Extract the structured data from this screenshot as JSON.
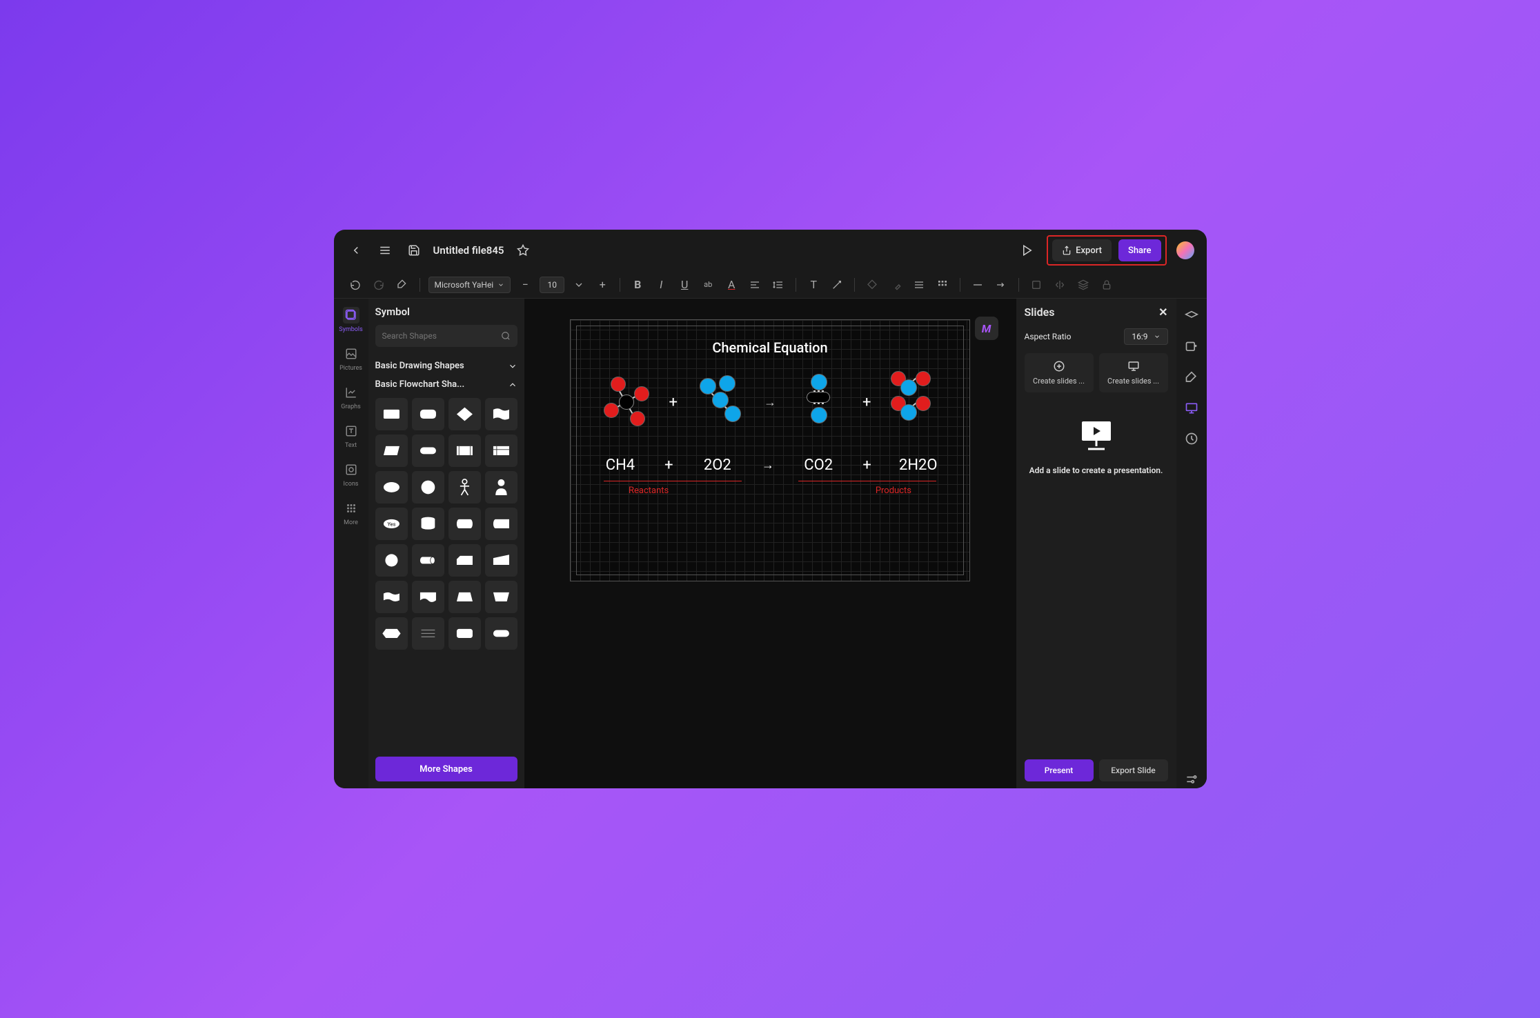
{
  "titlebar": {
    "filename": "Untitled file845",
    "export_label": "Export",
    "share_label": "Share"
  },
  "toolbar": {
    "font": "Microsoft YaHei",
    "size": "10"
  },
  "leftrail": {
    "items": [
      {
        "label": "Symbols",
        "icon": "shapes"
      },
      {
        "label": "Pictures",
        "icon": "image"
      },
      {
        "label": "Graphs",
        "icon": "chart"
      },
      {
        "label": "Text",
        "icon": "text"
      },
      {
        "label": "Icons",
        "icon": "target"
      },
      {
        "label": "More",
        "icon": "grid"
      }
    ]
  },
  "shapes": {
    "title": "Symbol",
    "search_placeholder": "Search Shapes",
    "section1": "Basic Drawing Shapes",
    "section2": "Basic Flowchart Sha...",
    "more_label": "More Shapes",
    "yes_label": "Yes"
  },
  "canvas": {
    "title": "Chemical Equation",
    "ops": [
      "+",
      "→",
      "+"
    ],
    "equation": [
      "CH4",
      "+",
      "2O2",
      "→",
      "CO2",
      "+",
      "2H2O"
    ],
    "reactants_label": "Reactants",
    "products_label": "Products"
  },
  "right": {
    "title": "Slides",
    "aspect_label": "Aspect Ratio",
    "aspect_value": "16:9",
    "create1": "Create slides ...",
    "create2": "Create slides ...",
    "empty_text": "Add a slide to create a presentation.",
    "present_label": "Present",
    "export_label": "Export Slide"
  }
}
